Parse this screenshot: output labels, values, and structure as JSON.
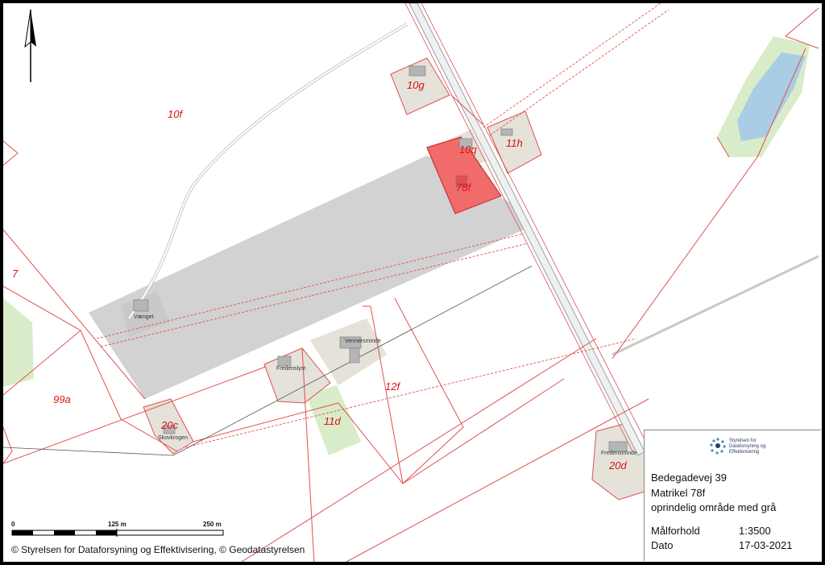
{
  "map": {
    "parcels": {
      "p10f": "10f",
      "p10g": "10g",
      "p10q": "10q",
      "p11h": "11h",
      "p78f": "78f",
      "p7": "7",
      "p99a": "99a",
      "p20c": "20c",
      "p11d": "11d",
      "p12f": "12f",
      "p20d": "20d"
    },
    "place_names": {
      "vaenget": "Vænget",
      "fredenslyst": "Fredenslyst",
      "vennersminde": "Vennersminde",
      "skovkrogen": "Skovkrogen",
      "fredensminde": "Fredensminde"
    },
    "colors": {
      "highlight": "#f26b6b",
      "original_area": "#d2d2d2",
      "parcel_line": "#e05050",
      "road": "#9aa0a6",
      "water": "#a9cde4",
      "green": "#d9ecc9"
    }
  },
  "info": {
    "logo_text": "Styrelsen for Dataforsyning og Effektivisering",
    "address": "Bedegadevej 39",
    "parcel": "Matrikel 78f",
    "note": "oprindelig område med grå",
    "scale_label": "Målforhold",
    "scale_value": "1:3500",
    "date_label": "Dato",
    "date_value": "17-03-2021"
  },
  "scalebar": {
    "zero": "0",
    "mid": "125 m",
    "end": "250 m"
  },
  "copyright": "© Styrelsen for Dataforsyning og Effektivisering, © Geodatastyrelsen"
}
